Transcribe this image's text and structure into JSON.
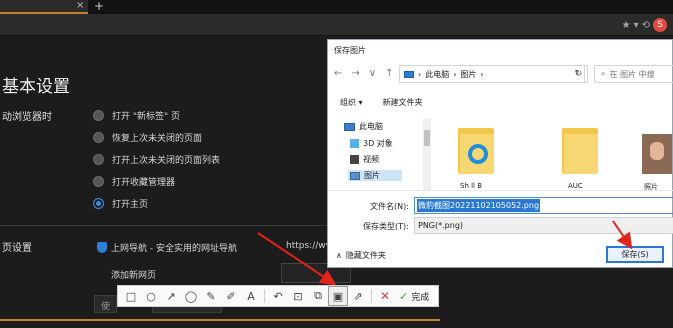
{
  "browser": {
    "tab_close": "×",
    "tab_new": "+",
    "addr_icons": [
      "★",
      "▾",
      "⟲"
    ],
    "addr_badge": "S"
  },
  "settings": {
    "title": "基本设置",
    "startup_label": "动浏览器时",
    "options": [
      {
        "label": "打开 \"新标签\" 页",
        "selected": false
      },
      {
        "label": "恢复上次未关闭的页面",
        "selected": false
      },
      {
        "label": "打开上次未关闭的页面列表",
        "selected": false
      },
      {
        "label": "打开收藏管理器",
        "selected": false
      },
      {
        "label": "打开主页",
        "selected": true
      }
    ],
    "home_label": "页设置",
    "nav_item": "上网导航 - 安全实用的网址导航",
    "url_hint": "https://wv",
    "add_link": "添加新网页",
    "bottom_buttons": [
      "使",
      "..."
    ]
  },
  "toolbar": {
    "tools": [
      "□",
      "○",
      "↗",
      "◯",
      "✎",
      "✐",
      "A",
      "↶",
      "⊡",
      "⧉",
      "▣",
      "⇗"
    ],
    "cancel": "✕",
    "done_check": "✓",
    "done_label": "完成"
  },
  "dialog": {
    "title": "保存图片",
    "nav": [
      "←",
      "→",
      "∨",
      "↑"
    ],
    "path": [
      "此电脑",
      "›",
      "图片",
      "›"
    ],
    "path_dropdown": "∨",
    "refresh": "↻",
    "search_icon": "⌕",
    "search_placeholder": "在 图片 中搜",
    "cmd_organize": "组织 ▾",
    "cmd_new_folder": "新建文件夹",
    "tree": [
      {
        "label": "此电脑",
        "icon": "pc"
      },
      {
        "label": "3D 对象",
        "icon": "3d"
      },
      {
        "label": "视频",
        "icon": "video"
      },
      {
        "label": "图片",
        "icon": "pic"
      }
    ],
    "files": [
      "Sh ll B",
      "AUC",
      "照片"
    ],
    "filename_label": "文件名(N):",
    "filename_value": "微豹截图20221102105052.png",
    "filetype_label": "保存类型(T):",
    "filetype_value": "PNG(*.png)",
    "hide_folders": "隐藏文件夹",
    "hide_chevron": "∧",
    "save_button": "保存(S)"
  }
}
